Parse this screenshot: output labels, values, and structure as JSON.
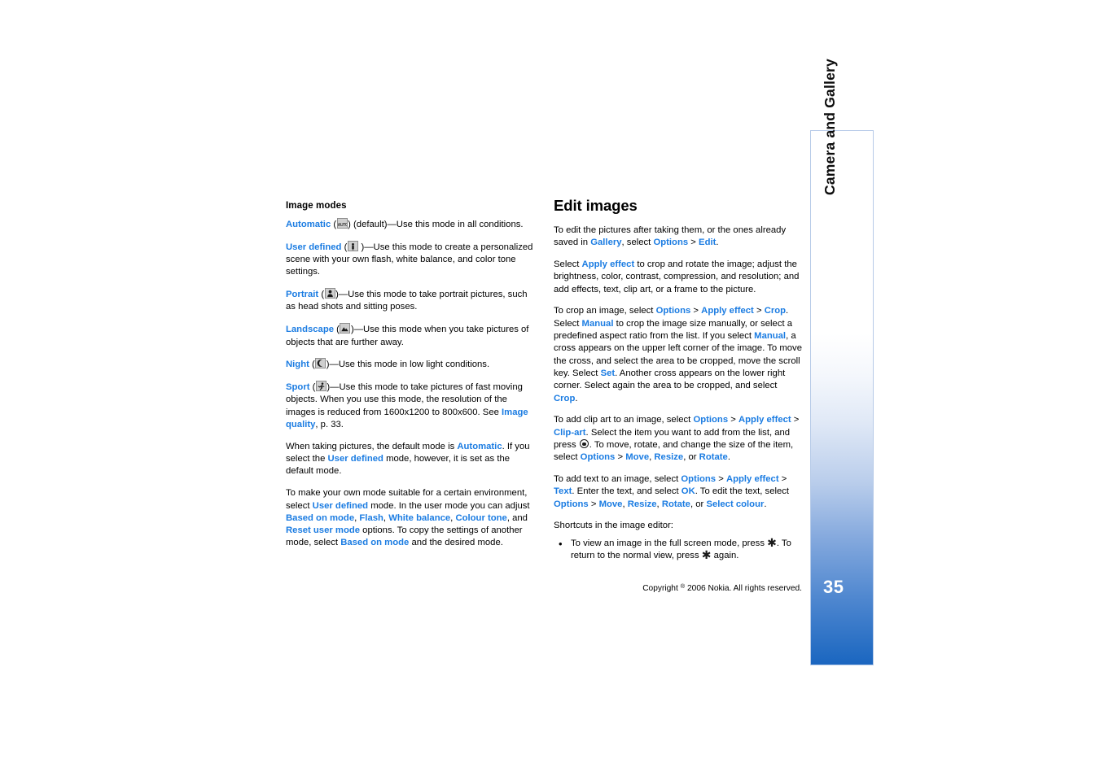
{
  "page": {
    "number": "35",
    "chapter_tab_title": "Camera and Gallery",
    "copyright": "Copyright © 2006 Nokia. All rights reserved.",
    "copyright_prefix": "Copyright ",
    "copyright_sup": "®",
    "copyright_suffix": " 2006 Nokia. All rights reserved.",
    "accent_blue": "#1b7ce2",
    "tab_blue": "#1a66c0",
    "tab_border": "#b7cbe8"
  },
  "left_column": {
    "heading": "Image modes",
    "modes": [
      {
        "name": "Automatic",
        "icon": "auto-mode-icon",
        "icon_label": "AUTO",
        "text_after": " (default)—Use this mode in all conditions."
      },
      {
        "name": "User defined",
        "icon": "user-defined-mode-icon",
        "text_after": "—Use this mode to create a personalized scene with your own flash, white balance, and color tone settings."
      },
      {
        "name": "Portrait",
        "icon": "portrait-mode-icon",
        "text_after": "—Use this mode to take portrait pictures, such as head shots and sitting poses."
      },
      {
        "name": "Landscape",
        "icon": "landscape-mode-icon",
        "text_after": "—Use this mode when you take pictures of objects that are further away."
      },
      {
        "name": "Night",
        "icon": "night-mode-icon",
        "text_after": "—Use this mode in low light conditions."
      }
    ],
    "sport_mode": {
      "name": "Sport",
      "icon": "sport-mode-icon",
      "text_1": "—Use this mode to take pictures of fast moving objects. When you use this mode, the resolution of the images is reduced from 1600x1200 to 800x600. See ",
      "link_image_quality": "Image quality",
      "text_2": ", p. 33."
    },
    "para_default": {
      "t1": "When taking pictures, the default mode is ",
      "l1": "Automatic",
      "t2": ". If you select the ",
      "l2": "User defined",
      "t3": " mode, however, it is set as the default mode."
    },
    "para_custom": {
      "t1": "To make your own mode suitable for a certain environment, select ",
      "l1": "User defined",
      "t2": " mode. In the user mode you can adjust ",
      "l2": "Based on mode",
      "t3": ", ",
      "l3": "Flash",
      "t4": ", ",
      "l4": "White balance",
      "t5": ", ",
      "l5": "Colour tone",
      "t6": ", and ",
      "l6": "Reset user mode",
      "t7": " options. To copy the settings of another mode, select ",
      "l7": "Based on mode",
      "t8": " and the desired mode."
    }
  },
  "right_column": {
    "heading": "Edit images",
    "para_intro": {
      "t1": "To edit the pictures after taking them, or the ones already saved in ",
      "l1": "Gallery",
      "t2": ", select ",
      "l2": "Options",
      "t3": " > ",
      "l3": "Edit",
      "t4": "."
    },
    "para_apply": {
      "t1": "Select ",
      "l1": "Apply effect",
      "t2": " to crop and rotate the image; adjust the brightness, color, contrast, compression, and resolution; and add effects, text, clip art, or a frame to the picture."
    },
    "para_crop": {
      "t1": "To crop an image, select ",
      "l1": "Options",
      "t2": " > ",
      "l2": "Apply effect",
      "t3": " > ",
      "l3": "Crop",
      "t4": ". Select ",
      "l4": "Manual",
      "t5": " to crop the image size manually, or select a predefined aspect ratio from the list. If you select ",
      "l5": "Manual",
      "t6": ", a cross appears on the upper left corner of the image. To move the cross, and select the area to be cropped, move the scroll key. Select ",
      "l6": "Set",
      "t7": ". Another cross appears on the lower right corner. Select again the area to be cropped, and select ",
      "l7": "Crop",
      "t8": "."
    },
    "para_clipart": {
      "t1": "To add clip art to an image, select ",
      "l1": "Options",
      "t2": " > ",
      "l2": "Apply effect",
      "t3": " > ",
      "l3": "Clip-art",
      "t4": ". Select the item you want to add from the list, and press ",
      "icon": "scroll-key-icon",
      "t5": ". To move, rotate, and change the size of the item, select ",
      "l4": "Options",
      "t6": " > ",
      "l5": "Move",
      "t7": ", ",
      "l6": "Resize",
      "t8": ", or ",
      "l7": "Rotate",
      "t9": "."
    },
    "para_text": {
      "t1": "To add text to an image, select ",
      "l1": "Options",
      "t2": " > ",
      "l2": "Apply effect",
      "t3": " > ",
      "l3": "Text",
      "t4": ". Enter the text, and select ",
      "l4": "OK",
      "t5": ". To edit the text, select ",
      "l5": "Options",
      "t6": " > ",
      "l6": "Move",
      "t7": ", ",
      "l7": "Resize",
      "t8": ", ",
      "l8": "Rotate",
      "t9": ", or ",
      "l9": "Select colour",
      "t10": "."
    },
    "shortcuts_heading": "Shortcuts in the image editor:",
    "shortcuts": [
      {
        "bullet": "•",
        "t1": "To view an image in the full screen mode, press ",
        "key1": "✱",
        "t2": ". To return to the normal view, press ",
        "key2": "✱",
        "t3": " again."
      }
    ]
  }
}
